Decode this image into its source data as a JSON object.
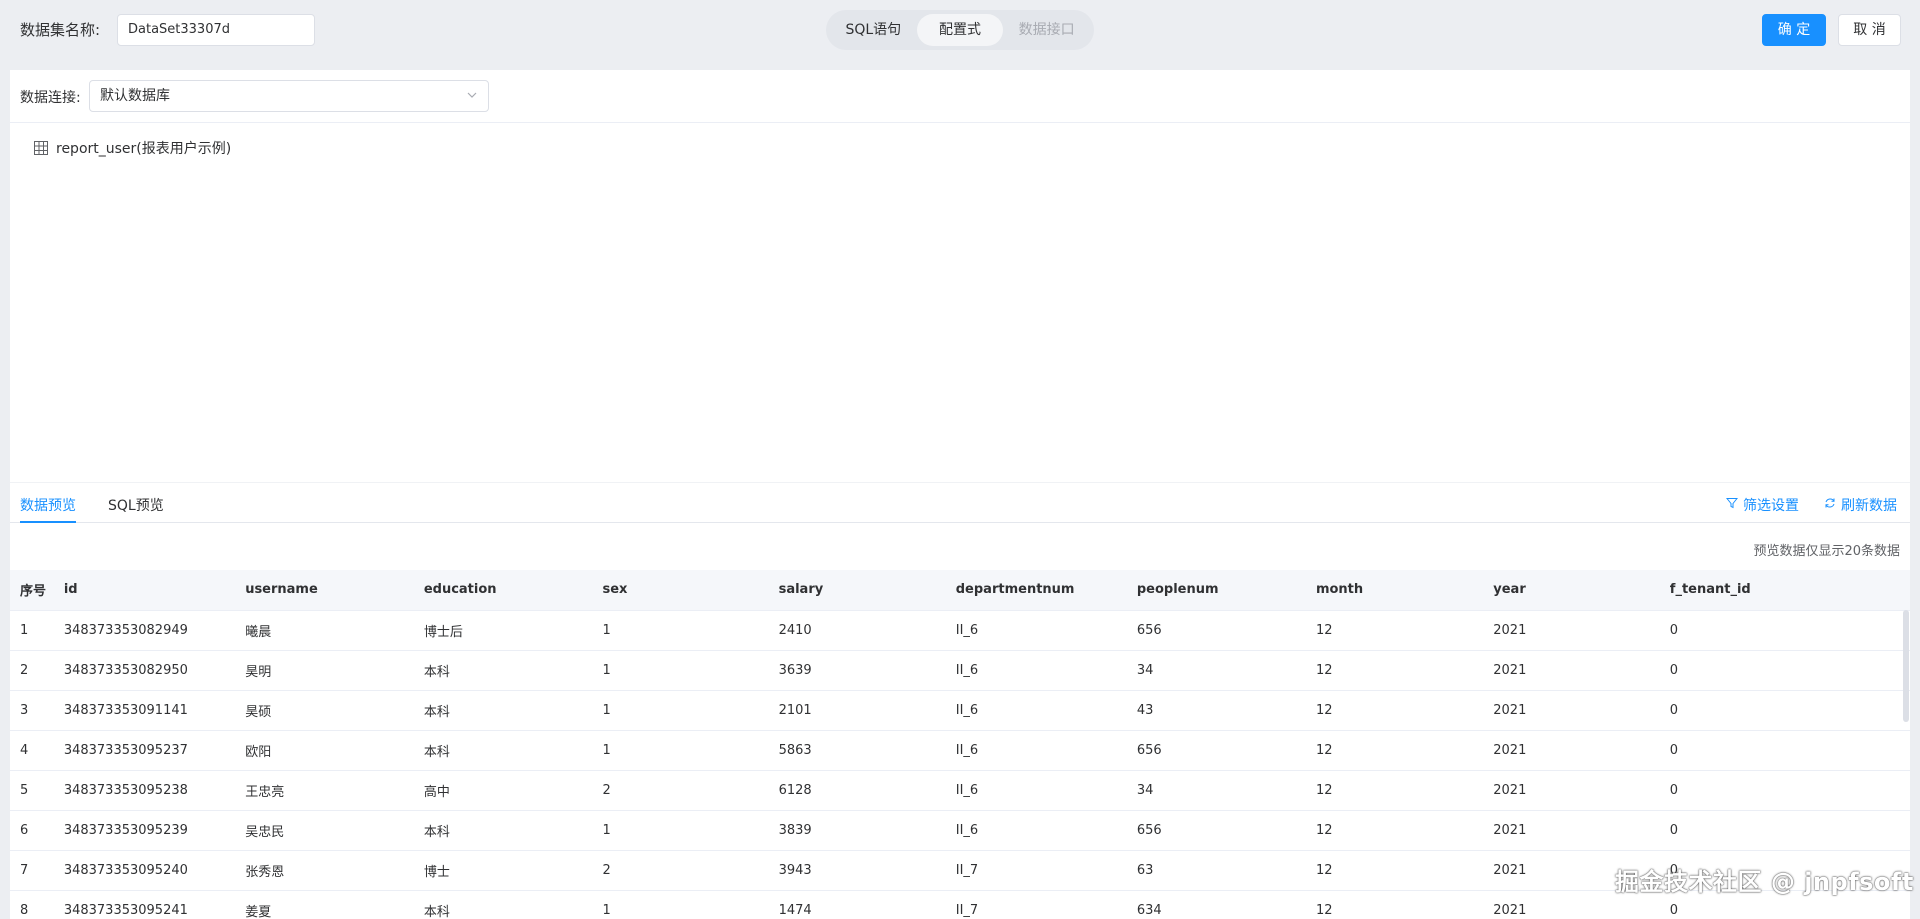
{
  "header": {
    "dataset_label": "数据集名称:",
    "dataset_name": "DataSet33307d",
    "modes": [
      {
        "label": "SQL语句"
      },
      {
        "label": "配置式"
      },
      {
        "label": "数据接口"
      }
    ],
    "ok_label": "确 定",
    "cancel_label": "取 消"
  },
  "connection": {
    "label": "数据连接:",
    "selected": "默认数据库"
  },
  "tree": {
    "table_name": "report_user(报表用户示例)"
  },
  "tabs": {
    "data_preview": "数据预览",
    "sql_preview": "SQL预览",
    "filter": "筛选设置",
    "refresh": "刷新数据"
  },
  "preview_note": "预览数据仅显示20条数据",
  "table": {
    "columns": [
      "序号",
      "id",
      "username",
      "education",
      "sex",
      "salary",
      "departmentnum",
      "peoplenum",
      "month",
      "year",
      "f_tenant_id"
    ],
    "rows": [
      [
        "1",
        "348373353082949",
        "曦晨",
        "博士后",
        "1",
        "2410",
        "II_6",
        "656",
        "12",
        "2021",
        "0"
      ],
      [
        "2",
        "348373353082950",
        "昊明",
        "本科",
        "1",
        "3639",
        "II_6",
        "34",
        "12",
        "2021",
        "0"
      ],
      [
        "3",
        "348373353091141",
        "昊硕",
        "本科",
        "1",
        "2101",
        "II_6",
        "43",
        "12",
        "2021",
        "0"
      ],
      [
        "4",
        "348373353095237",
        "欧阳",
        "本科",
        "1",
        "5863",
        "II_6",
        "656",
        "12",
        "2021",
        "0"
      ],
      [
        "5",
        "348373353095238",
        "王忠亮",
        "高中",
        "2",
        "6128",
        "II_6",
        "34",
        "12",
        "2021",
        "0"
      ],
      [
        "6",
        "348373353095239",
        "吴忠民",
        "本科",
        "1",
        "3839",
        "II_6",
        "656",
        "12",
        "2021",
        "0"
      ],
      [
        "7",
        "348373353095240",
        "张秀恩",
        "博士",
        "2",
        "3943",
        "II_7",
        "63",
        "12",
        "2021",
        "0"
      ],
      [
        "8",
        "348373353095241",
        "姜夏",
        "本科",
        "1",
        "1474",
        "II_7",
        "634",
        "12",
        "2021",
        "0"
      ]
    ]
  },
  "watermark": "掘金技术社区 @ jnpfsoft",
  "colors": {
    "accent": "#1890ff",
    "background": "#eceef2"
  }
}
